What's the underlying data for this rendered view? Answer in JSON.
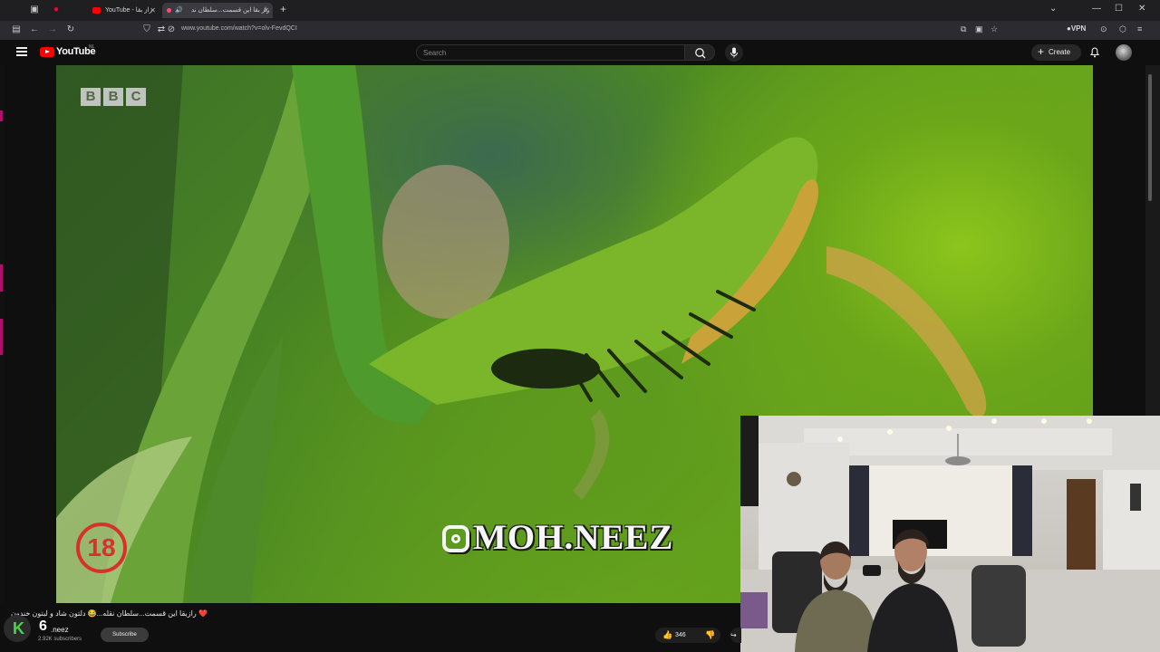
{
  "browser": {
    "tabs": [
      {
        "label": "YouTube - راز بقا",
        "active": false
      },
      {
        "label": "راز بقا این قسمت...سلطان ند",
        "active": true
      }
    ],
    "url": "www.youtube.com/watch?v=olv-FevdQCI",
    "vpn_label": "VPN"
  },
  "youtube": {
    "logo_text": "YouTube",
    "logo_region": "NL",
    "search_placeholder": "Search",
    "create_label": "Create"
  },
  "video": {
    "bbc_letters": [
      "B",
      "B",
      "C"
    ],
    "age_badge": "18",
    "watermark": "MOH.NEEZ"
  },
  "below_video": {
    "title": "❤️ رازبقا این قسمت...سلطان نقله...😂 دلتون شاد و لبتون خندون",
    "channel_digit": "6",
    "channel_name": ".neez",
    "subscribers": "2.92K subscribers",
    "subscribe_label": "Subscribe",
    "likes": "346"
  },
  "colors": {
    "accent": "#ff0000",
    "badge_red": "#d6312c",
    "page_bg": "#0f0f0f"
  }
}
